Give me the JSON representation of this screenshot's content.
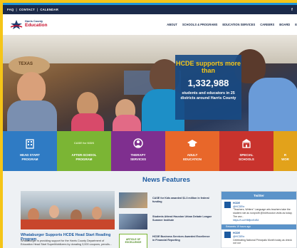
{
  "topbar": {
    "links": [
      "FAQ",
      "CONTACT",
      "CALENDAR"
    ],
    "separator": "|",
    "social_icon": "facebook-icon",
    "social_glyph": "f"
  },
  "header": {
    "logo_line1": "Harris County",
    "logo_line2": "Education",
    "logo_icon": "star-logo-icon",
    "nav": [
      "ABOUT",
      "SCHOOLS & PROGRAMS",
      "EDUCATION SERVICES",
      "CAREERS",
      "BOARD",
      "E"
    ]
  },
  "hero": {
    "hat_text": "TEXAS",
    "stat_heading": "HCDE supports more than",
    "stat_number": "1,332,988",
    "stat_text": "students and educators in 25 districts around Harris County"
  },
  "tiles": [
    {
      "label": "HEAD START\nPROGRAM",
      "color": "#2f7bc4",
      "icon": "building-icon"
    },
    {
      "label": "AFTER-SCHOOL\nPROGRAM",
      "color": "#7bb534",
      "icon": "case-for-kids-icon",
      "logo_text": "CASE for KIDS"
    },
    {
      "label": "THERAPY\nSERVICES",
      "color": "#7f2f8f",
      "icon": "therapy-icon"
    },
    {
      "label": "ADULT\nEDUCATION",
      "color": "#e8672a",
      "icon": "graduation-cap-icon"
    },
    {
      "label": "SPECIAL\nSCHOOLS",
      "color": "#c8332d",
      "icon": "school-icon"
    },
    {
      "label": "R\nWOR",
      "color": "#e2a21b",
      "icon": "partial-tile-icon"
    }
  ],
  "news": {
    "heading": "News Features",
    "feature_title": "Whataburger Supports HCDE Head Start Reading Program",
    "feature_text": "Whataburger is providing support for the Harris County Department of Education Head Start SuperMobilizers by donating 3,000 coupons, pencils...",
    "items": [
      {
        "text": "CASE for Kids awarded $1.3 million in federal funding"
      },
      {
        "text": "Students Attend Houston Urban Debate League Summer Institute"
      },
      {
        "text": "HCDE Business Services Awarded Excellence in Financial Reporting",
        "thumb_text": "ARTICLE OF EXCELLENCE"
      }
    ]
  },
  "twitter": {
    "heading": "Twitter",
    "tweets": [
      {
        "who": "HCDE",
        "handle": "@HCDEtx",
        "text": "\"Teachers, Writers\" Language arts teachers take the student role as nonprofit @InkHouston visits as today. The wor...",
        "link": "https://t.co/HMfjnxKxB4"
      },
      {
        "who": "HCDE",
        "handle": "@HCDEtx",
        "text": "Celebrating National Principals Month today as check out our"
      }
    ],
    "retweet_label": "Retweets 19 hours ago"
  }
}
